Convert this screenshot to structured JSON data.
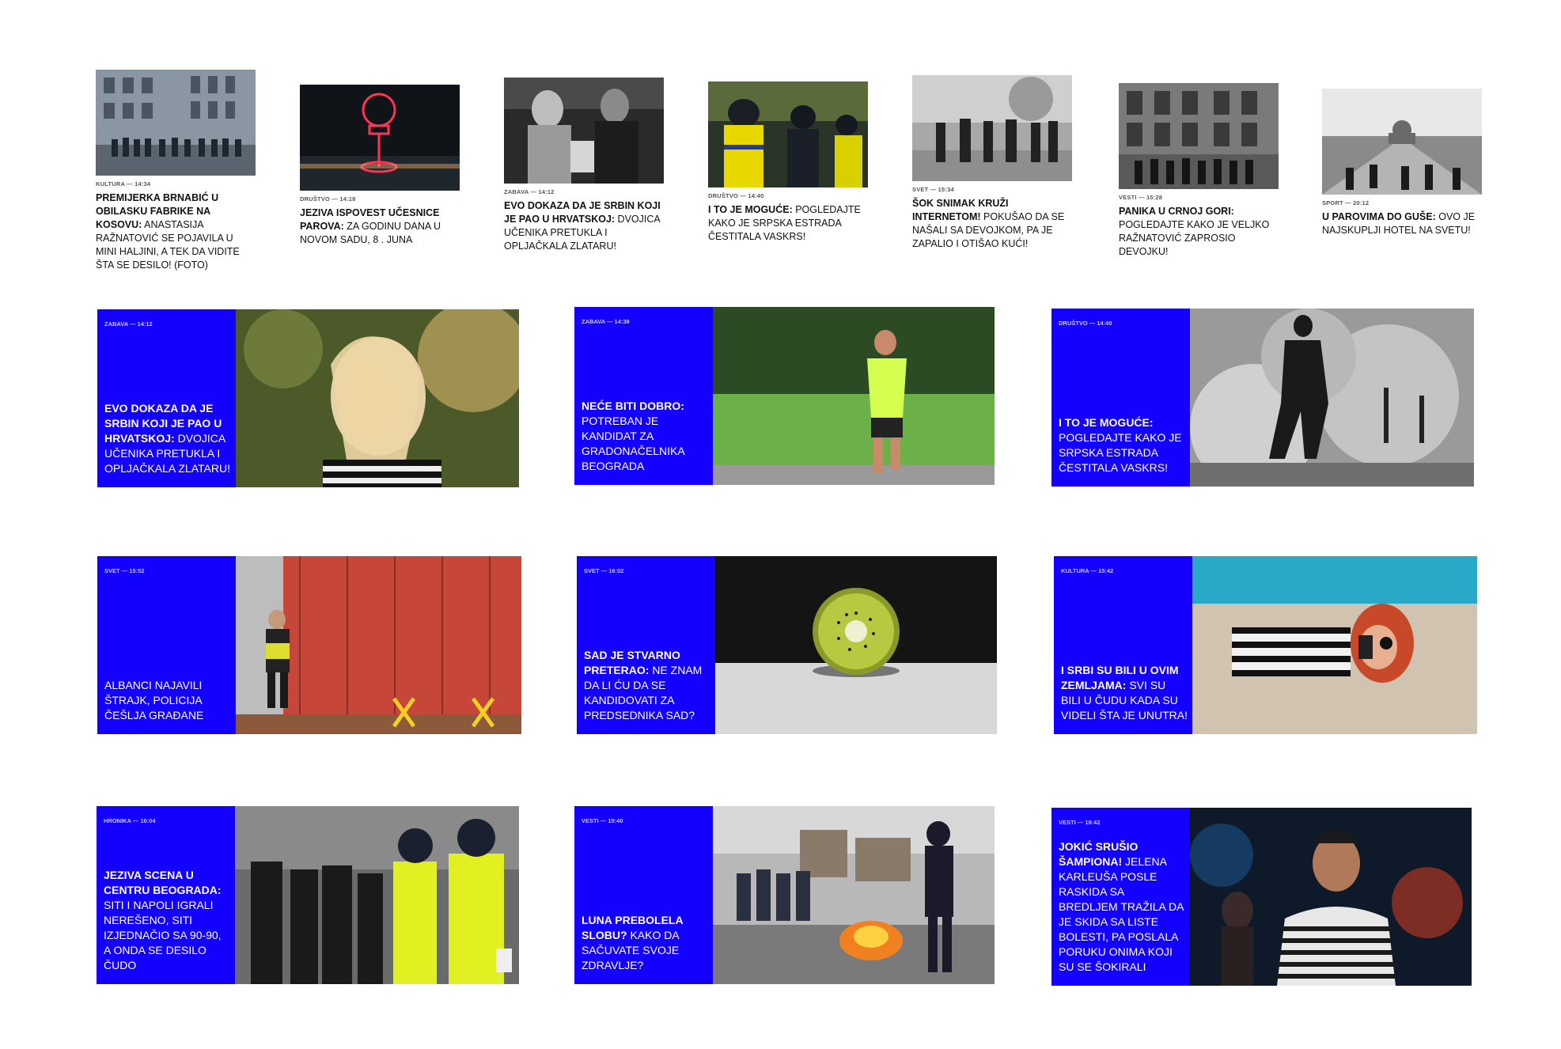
{
  "small_cards": [
    {
      "category": "KULTURA — 14:34",
      "bold": "PREMIJERKA BRNABIĆ U OBILASKU FABRIKE NA KOSOVU:",
      "text": " ANASTASIJA RAŽNATOVIĆ SE POJAVILA U MINI HALJINI, A TEK DA VIDITE ŠTA SE DESILO! (FOTO)"
    },
    {
      "category": "DRUŠTVO — 14:18",
      "bold": "JEZIVA ISPOVEST UČESNICE PAROVA:",
      "text": " ZA GODINU DANA U NOVOM SADU, 8 . JUNA"
    },
    {
      "category": "ZABAVA — 14:12",
      "bold": "EVO DOKAZA DA JE SRBIN KOJI JE PAO U HRVATSKOJ:",
      "text": " DVOJICA UČENIKA PRETUKLA I OPLJAČKALA ZLATARU!"
    },
    {
      "category": "DRUŠTVO — 14:40",
      "bold": "I TO JE MOGUĆE:",
      "text": " POGLEDAJTE KAKO JE SRPSKA ESTRADA ČESTITALA VASKRS!"
    },
    {
      "category": "SVET — 15:34",
      "bold": "ŠOK SNIMAK KRUŽI INTERNETOM!",
      "text": " POKUŠAO DA SE NAŠALI SA DEVOJKOM, PA JE ZAPALIO I OTIŠAO KUĆI!"
    },
    {
      "category": "VESTI — 15:28",
      "bold": "PANIKA U CRNOJ GORI:",
      "text": " POGLEDAJTE KAKO JE VELJKO RAŽNATOVIĆ ZAPROSIO DEVOJKU!"
    },
    {
      "category": "SPORT — 20:12",
      "bold": "U PAROVIMA DO GUŠE:",
      "text": " OVO JE NAJSKUPLJI HOTEL NA SVETU!"
    }
  ],
  "big_cards": [
    {
      "category": "ZABAVA — 14:12",
      "bold": "EVO DOKAZA DA JE SRBIN KOJI JE PAO U HRVATSKOJ:",
      "text": " DVOJICA UČENIKA PRETUKLA I OPLJAČKALA ZLATARU!"
    },
    {
      "category": "ZABAVA — 14:38",
      "bold": "NEĆE BITI DOBRO:",
      "text": " POTREBAN JE KANDIDAT ZA GRADONAČELNIKA BEOGRADA"
    },
    {
      "category": "DRUŠTVO — 14:40",
      "bold": "I TO JE MOGUĆE:",
      "text": " POGLEDAJTE KAKO JE SRPSKA ESTRADA ČESTITALA VASKRS!"
    },
    {
      "category": "SVET — 15:52",
      "bold": "",
      "text": "ALBANCI NAJAVILI ŠTRAJK, POLICIJA ČEŠLJA GRAĐANE"
    },
    {
      "category": "SVET — 16:02",
      "bold": "SAD JE STVARNO PRETERAO:",
      "text": " NE ZNAM DA LI ĆU DA SE KANDIDOVATI ZA PREDSEDNIKA SAD?"
    },
    {
      "category": "KULTURA — 15:42",
      "bold": "I SRBI SU BILI U OVIM ZEMLJAMA:",
      "text": " SVI SU BILI U ČUDU KADA SU VIDELI ŠTA JE UNUTRA!"
    },
    {
      "category": "HRONIKA — 16:04",
      "bold": "JEZIVA SCENA U CENTRU BEOGRADA:",
      "text": " SITI I NAPOLI IGRALI NEREŠENO, SITI IZJEDNAČIO SA 90-90, A ONDA SE DESILO ČUDO"
    },
    {
      "category": "VESTI — 19:40",
      "bold": "LUNA PREBOLELA SLOBU?",
      "text": " KAKO DA SAČUVATE SVOJE ZDRAVLJE?"
    },
    {
      "category": "VESTI — 19:42",
      "bold": "JOKIĆ SRUŠIO ŠAMPIONA!",
      "text": " JELENA KARLEUŠA POSLE RASKIDA SA BREDLJEM TRAŽILA DA JE SKIDA SA LISTE BOLESTI, PA POSLALA PORUKU ONIMA KOJI SU SE ŠOKIRALI"
    }
  ],
  "colors": {
    "panel_blue": "#1400ff",
    "meta_blue_light": "#c9c6ff"
  }
}
